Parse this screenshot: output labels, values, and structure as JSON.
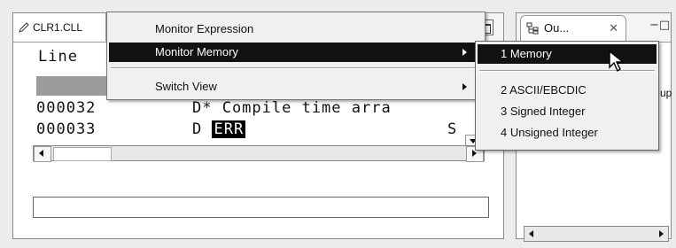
{
  "editor": {
    "tab_label": "CLR1.CLL",
    "header_text": "Line",
    "rows": [
      {
        "number": "000032",
        "code": "D*  Compile time arra"
      },
      {
        "number": "000033",
        "code_prefix": "D ",
        "highlight": "ERR",
        "suffix": "S"
      }
    ]
  },
  "outline": {
    "tab_label": "Ou...",
    "close_glyph": "✕",
    "min_glyph": "−□",
    "side_text": "up"
  },
  "context_menu": {
    "items": [
      {
        "label": "Monitor Expression",
        "highlighted": false,
        "submenu": false
      },
      {
        "label": "Monitor Memory",
        "highlighted": true,
        "submenu": true
      },
      {
        "label": "Switch View",
        "highlighted": false,
        "submenu": true
      }
    ]
  },
  "submenu": {
    "items": [
      {
        "label": "1 Memory",
        "highlighted": true
      },
      {
        "label": "2 ASCII/EBCDIC",
        "highlighted": false
      },
      {
        "label": "3 Signed Integer",
        "highlighted": false
      },
      {
        "label": "4 Unsigned Integer",
        "highlighted": false
      }
    ]
  },
  "colors": {
    "highlight": "#111111",
    "panel": "#ececec"
  }
}
